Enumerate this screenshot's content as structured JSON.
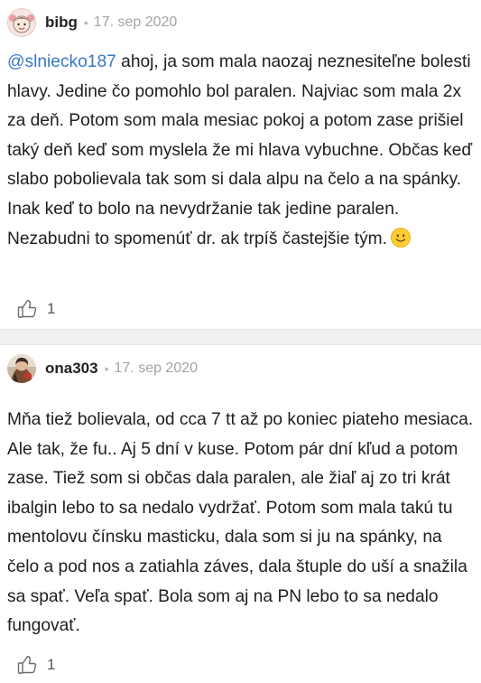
{
  "comments": [
    {
      "username": "bibg",
      "separator": "•",
      "date": "17. sep 2020",
      "mention": "@slniecko187",
      "text": " ahoj, ja som mala naozaj neznesiteľne bolesti hlavy. Jedine čo pomohlo bol paralen. Najviac som mala 2x za deň. Potom som mala mesiac pokoj a potom zase prišiel taký deň keď som myslela že mi hlava vybuchne. Občas keď slabo pobolievala tak som si dala alpu na čelo a na spánky. Inak keď to bolo na nevydržanie tak jedine paralen. Nezabudni to spomenúť dr. ak trpíš častejšie tým.",
      "emoji": "slightly-smiling-face-icon",
      "likes": "1"
    },
    {
      "username": "ona303",
      "separator": "•",
      "date": "17. sep 2020",
      "text": "Mňa tiež bolievala, od cca 7 tt až po koniec piateho mesiaca. Ale tak, že fu.. Aj 5 dní v kuse. Potom pár dní kľud a potom zase. Tiež som si občas dala paralen, ale žiaľ aj zo tri krát ibalgin lebo to sa nedalo vydržať. Potom som mala takú tu mentolovu čínsku masticku, dala som si ju na spánky, na čelo a pod nos a zatiahla záves, dala štuple do uší a snažila sa spať. Veľa spať. Bola som aj na PN lebo to sa nedalo fungovať.",
      "likes": "1"
    }
  ],
  "colors": {
    "mention": "#3a78c3",
    "meta": "#a3a3a9",
    "divider": "#f1f1f3",
    "emoji": "#ffcc33"
  },
  "icons": {
    "like": "thumbs-up-outline-icon",
    "avatar1": "girl-cartoon-avatar",
    "avatar2": "user-photo-avatar"
  }
}
